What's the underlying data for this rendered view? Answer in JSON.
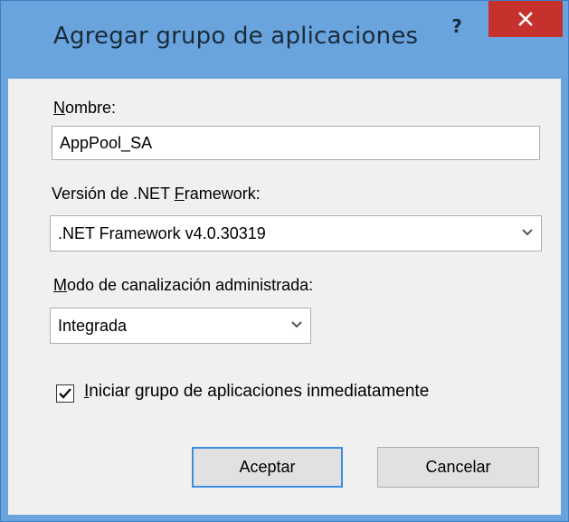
{
  "dialog": {
    "title": "Agregar grupo de aplicaciones",
    "help_label": "?"
  },
  "name_field": {
    "label_accel": "N",
    "label_rest": "ombre:",
    "value": "AppPool_SA"
  },
  "framework": {
    "label_pre": "Versión de .NET ",
    "label_accel": "F",
    "label_rest": "ramework:",
    "selected": ".NET Framework v4.0.30319"
  },
  "pipeline": {
    "label_accel": "M",
    "label_rest": "odo de canalización administrada:",
    "selected": "Integrada"
  },
  "start_immediately": {
    "label_accel": "I",
    "label_rest": "niciar grupo de aplicaciones inmediatamente",
    "checked": true
  },
  "buttons": {
    "ok_label": "Aceptar",
    "cancel_label": "Cancelar"
  },
  "colors": {
    "frame": "#69a4de",
    "close": "#c7312d",
    "client": "#f0f0f0",
    "default_button_border": "#3d8ee0"
  },
  "icons": [
    "help-icon",
    "close-icon",
    "chevron-down-icon",
    "checkmark-icon"
  ]
}
